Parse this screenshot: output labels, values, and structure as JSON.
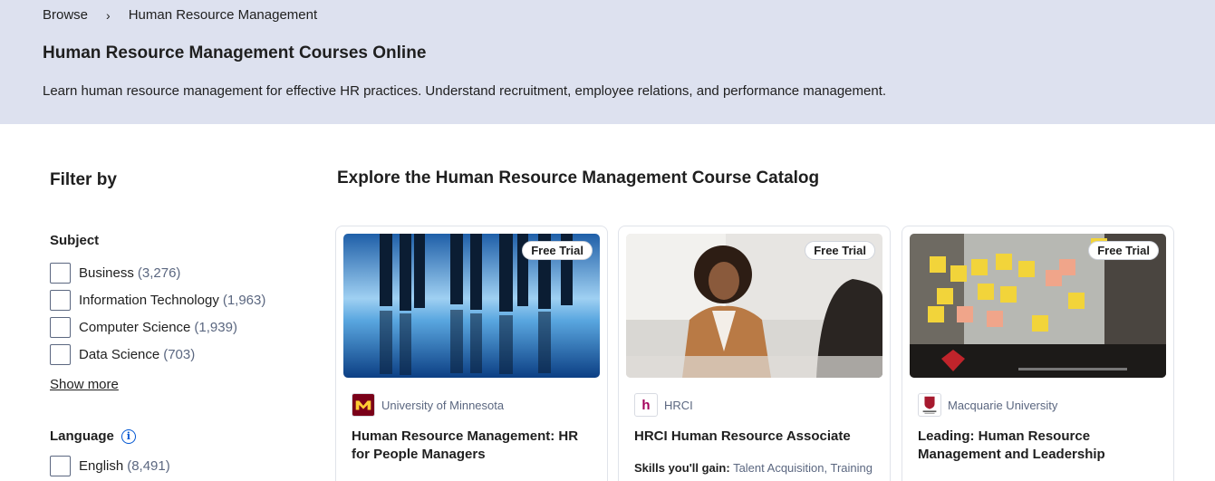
{
  "breadcrumb": {
    "items": [
      "Browse",
      "Human Resource Management"
    ],
    "separator": "›"
  },
  "hero": {
    "title": "Human Resource Management Courses Online",
    "description": "Learn human resource management for effective HR practices. Understand recruitment, employee relations, and performance management."
  },
  "filters": {
    "title": "Filter by",
    "subject": {
      "title": "Subject",
      "options": [
        {
          "label": "Business",
          "count": "(3,276)"
        },
        {
          "label": "Information Technology",
          "count": "(1,963)"
        },
        {
          "label": "Computer Science",
          "count": "(1,939)"
        },
        {
          "label": "Data Science",
          "count": "(703)"
        }
      ],
      "show_more": "Show more"
    },
    "language": {
      "title": "Language",
      "info_icon": "i",
      "options": [
        {
          "label": "English",
          "count": "(8,491)"
        }
      ]
    }
  },
  "catalog": {
    "title": "Explore the Human Resource Management Course Catalog",
    "cards": [
      {
        "badge": "Free Trial",
        "partner": "University of Minnesota",
        "logo_text": "M",
        "title": "Human Resource Management: HR for People Managers",
        "skills_label": "",
        "skills": ""
      },
      {
        "badge": "Free Trial",
        "partner": "HRCI",
        "logo_text": "h",
        "title": "HRCI Human Resource Associate",
        "skills_label": "Skills you'll gain:",
        "skills": "Talent Acquisition, Training"
      },
      {
        "badge": "Free Trial",
        "partner": "Macquarie University",
        "logo_text": "",
        "title": "Leading: Human Resource Management and Leadership",
        "skills_label": "",
        "skills": ""
      }
    ]
  },
  "colors": {
    "hero_bg": "#dde1ef",
    "accent": "#0056d2",
    "umn_maroon": "#7a0019",
    "umn_gold": "#ffcc33",
    "hrci_magenta": "#a3005b",
    "macquarie_red": "#a6192e"
  }
}
